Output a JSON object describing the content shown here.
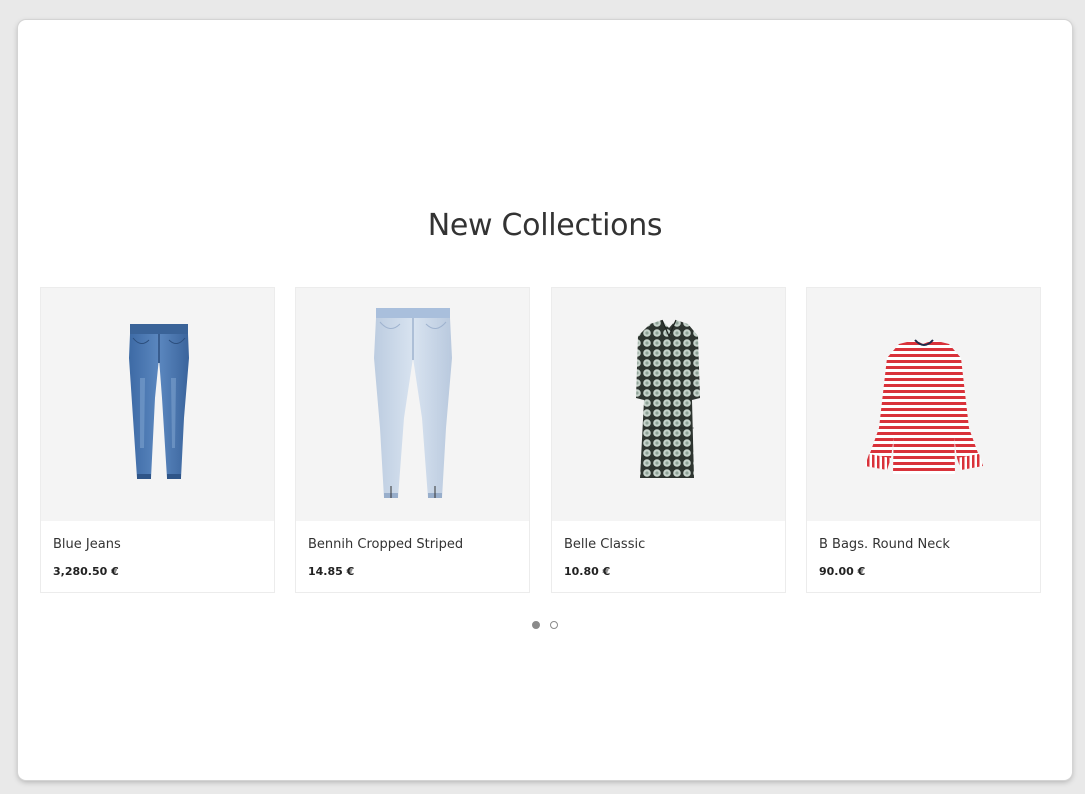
{
  "section": {
    "title": "New Collections"
  },
  "products": [
    {
      "name": "Blue Jeans",
      "price": "3,280.50 €",
      "image_icon": "blue-jeans-image"
    },
    {
      "name": "Bennih Cropped Striped",
      "price": "14.85 €",
      "image_icon": "light-jeans-image"
    },
    {
      "name": "Belle Classic",
      "price": "10.80 €",
      "image_icon": "patterned-dress-image"
    },
    {
      "name": "B Bags. Round Neck",
      "price": "90.00 €",
      "image_icon": "striped-top-image"
    }
  ],
  "pagination": {
    "pages": 2,
    "active_page": 1
  },
  "colors": {
    "background": "#ffffff",
    "image_background": "#f4f4f4",
    "dot_active": "#8a8a8a",
    "text": "#333333"
  }
}
